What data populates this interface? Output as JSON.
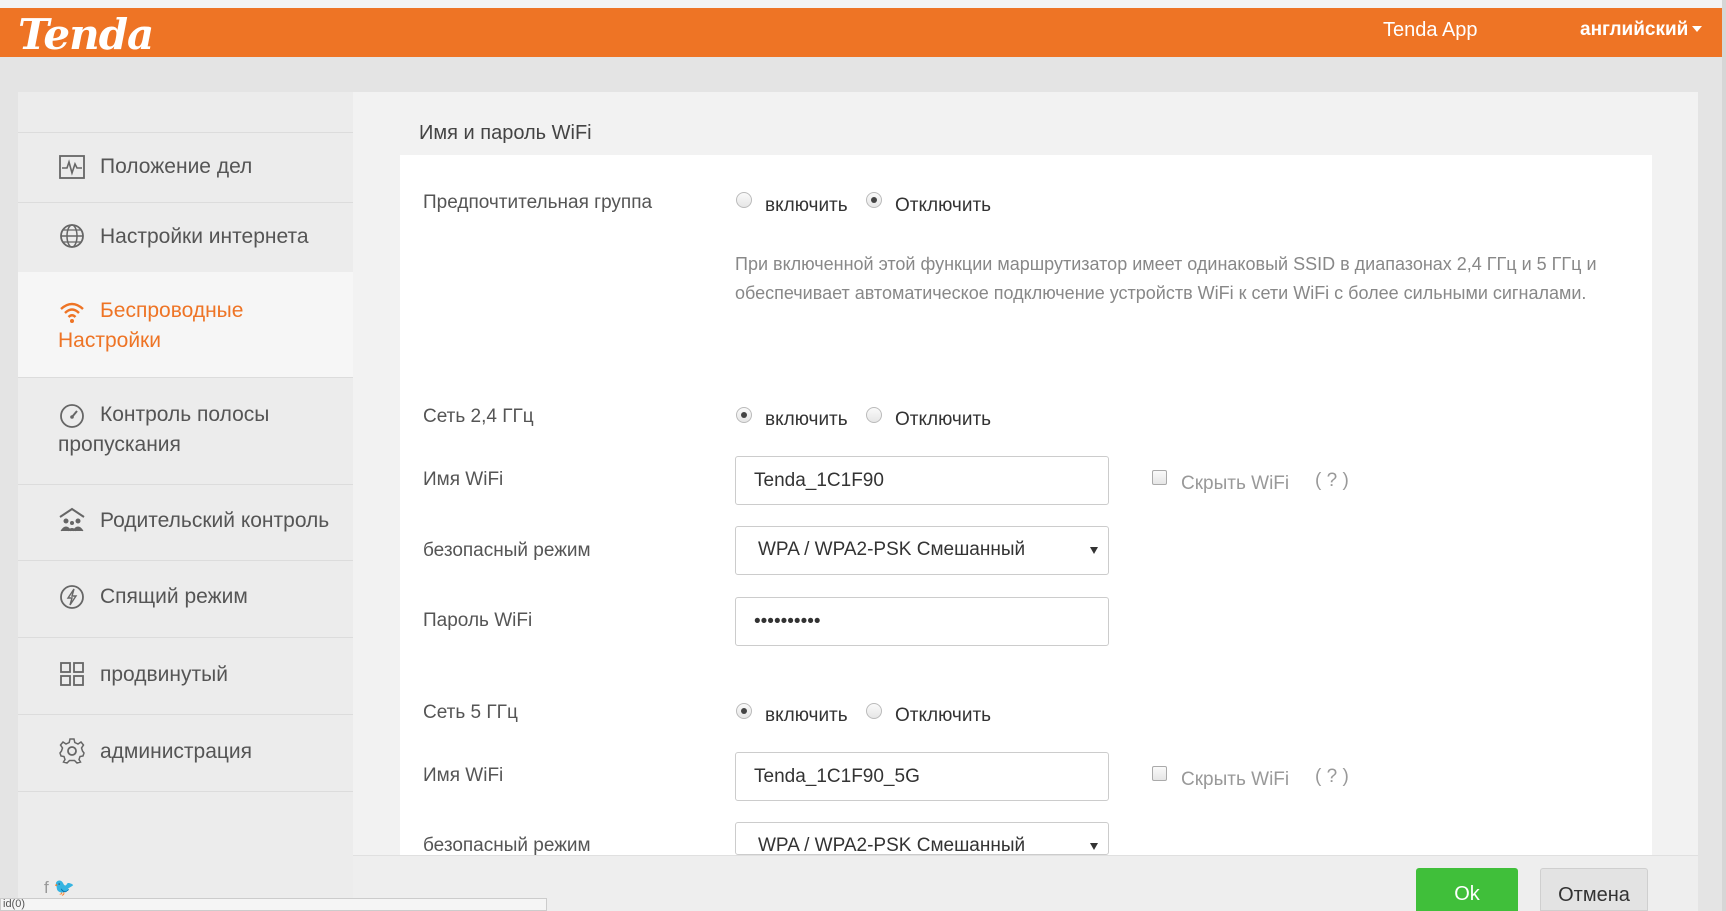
{
  "header": {
    "logo": "Tenda",
    "app_link": "Tenda App",
    "language": "английский"
  },
  "sidebar": {
    "items": [
      {
        "label": "Положение дел",
        "icon": "status-chart-icon"
      },
      {
        "label": "Настройки интернета",
        "icon": "globe-icon"
      },
      {
        "label_line1": "Беспроводные",
        "label_line2": "Настройки",
        "icon": "wifi-icon",
        "active": true
      },
      {
        "label_line1": "Контроль полосы",
        "label_line2": "пропускания",
        "icon": "speedometer-icon"
      },
      {
        "label": "Родительский контроль",
        "icon": "family-icon"
      },
      {
        "label": "Спящий режим",
        "icon": "sleep-power-icon"
      },
      {
        "label": "продвинутый",
        "icon": "grid-icon"
      },
      {
        "label": "администрация",
        "icon": "gear-icon"
      }
    ],
    "social": "f  🐦"
  },
  "section_title": "Имя и пароль WiFi",
  "form": {
    "preferred": {
      "label": "Предпочтительная группа",
      "enable": "включить",
      "disable": "Отключить",
      "selected": "disable",
      "description": "При включенной этой функции маршрутизатор имеет одинаковый SSID в диапазонах 2,4 ГГц и 5 ГГц и обеспечивает автоматическое подключение устройств WiFi к сети WiFi с более сильными сигналами."
    },
    "band24": {
      "label": "Сеть 2,4 ГГц",
      "enable": "включить",
      "disable": "Отключить",
      "selected": "enable",
      "ssid_label": "Имя WiFi",
      "ssid": "Tenda_1C1F90",
      "hide_label": "Скрыть WiFi",
      "help": "( ? )",
      "security_label": "безопасный режим",
      "security": "WPA / WPA2-PSK Смешанный",
      "password_label": "Пароль WiFi",
      "password": "••••••••••"
    },
    "band5": {
      "label": "Сеть 5 ГГц",
      "enable": "включить",
      "disable": "Отключить",
      "selected": "enable",
      "ssid_label": "Имя WiFi",
      "ssid": "Tenda_1C1F90_5G",
      "hide_label": "Скрыть WiFi",
      "help": "( ? )",
      "security_label": "безопасный режим",
      "security": "WPA / WPA2-PSK Смешанный"
    }
  },
  "buttons": {
    "ok": "Ok",
    "cancel": "Отмена"
  },
  "statusbar": "id(0)",
  "colors": {
    "accent": "#ee7425",
    "ok_button": "#40bf3a"
  }
}
